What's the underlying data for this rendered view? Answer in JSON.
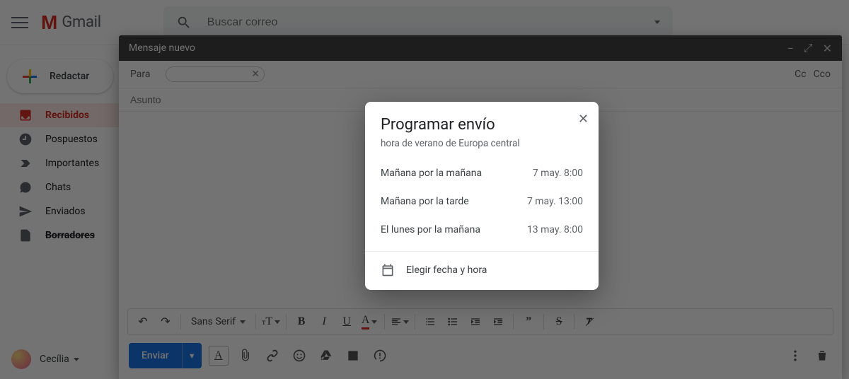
{
  "app": {
    "name": "Gmail"
  },
  "search": {
    "placeholder": "Buscar correo"
  },
  "compose_button": "Redactar",
  "sidebar": {
    "items": [
      {
        "label": "Recibidos"
      },
      {
        "label": "Pospuestos"
      },
      {
        "label": "Importantes"
      },
      {
        "label": "Chats"
      },
      {
        "label": "Enviados"
      },
      {
        "label": "Borradores"
      }
    ]
  },
  "account": {
    "name": "Cecília"
  },
  "compose": {
    "window_title": "Mensaje nuevo",
    "to_label": "Para",
    "cc_label": "Cc",
    "bcc_label": "Cco",
    "subject_placeholder": "Asunto",
    "font_family": "Sans Serif",
    "send_label": "Enviar"
  },
  "format": {
    "undo": "↶",
    "redo": "↷",
    "bold": "B",
    "italic": "I",
    "underline": "U",
    "textcolor": "A"
  },
  "schedule_modal": {
    "title": "Programar envío",
    "timezone": "hora de verano de Europa central",
    "options": [
      {
        "label": "Mañana por la mañana",
        "time": "7 may. 8:00"
      },
      {
        "label": "Mañana por la tarde",
        "time": "7 may. 13:00"
      },
      {
        "label": "El lunes por la mañana",
        "time": "13 may. 8:00"
      }
    ],
    "pick_label": "Elegir fecha y hora"
  }
}
